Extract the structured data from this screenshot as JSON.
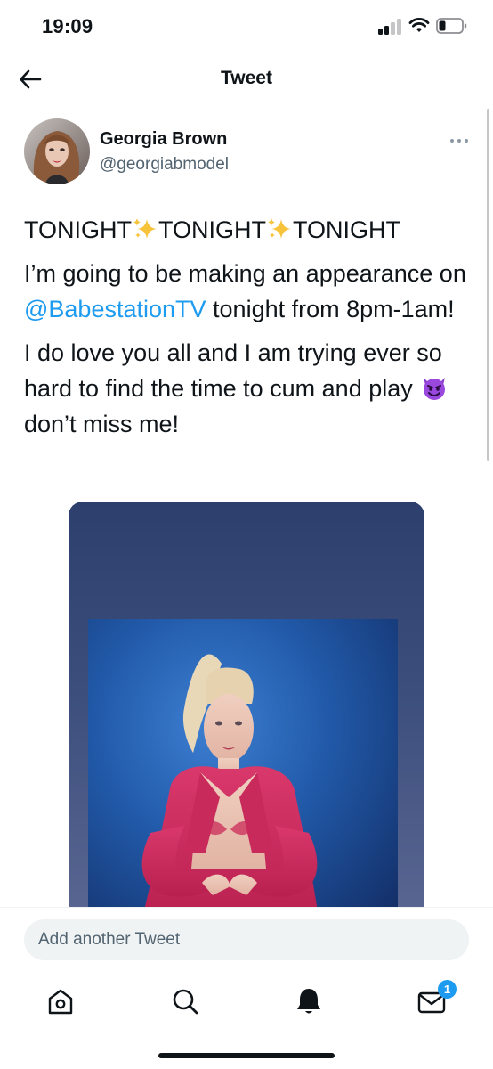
{
  "status_bar": {
    "time": "19:09"
  },
  "nav": {
    "title": "Tweet"
  },
  "tweet": {
    "author_name": "Georgia Brown",
    "author_handle": "@georgiabmodel",
    "line1_word": "TONIGHT",
    "para2_before": "I’m going to be making an appearance on ",
    "para2_mention": "@BabestationTV",
    "para2_after": " tonight from 8pm-1am!",
    "para3_before": "I do love you all and I am trying ever so hard to find the time to cum and play ",
    "para3_after": " don’t miss me!"
  },
  "composer": {
    "placeholder": "Add another Tweet"
  },
  "tabbar": {
    "messages_badge": "1"
  },
  "colors": {
    "accent": "#1d9bf0",
    "text": "#0f1419",
    "secondary": "#536471"
  }
}
